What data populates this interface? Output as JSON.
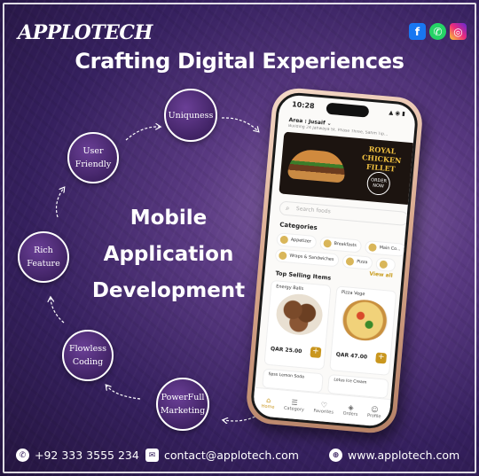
{
  "brand": {
    "logo_text": "APPLOTECH"
  },
  "social": [
    {
      "name": "facebook-icon",
      "glyph": "f"
    },
    {
      "name": "whatsapp-icon",
      "glyph": "✆"
    },
    {
      "name": "instagram-icon",
      "glyph": "◎"
    }
  ],
  "headline": "Crafting Digital Experiences",
  "center": {
    "line1": "Mobile",
    "line2": "Application",
    "line3": "Development"
  },
  "features": {
    "uniqueness": "Uniquness",
    "user_friendly_1": "User",
    "user_friendly_2": "Friendly",
    "rich_feature_1": "Rich",
    "rich_feature_2": "Feature",
    "flawless_coding_1": "Flowless",
    "flawless_coding_2": "Coding",
    "marketing_1": "PowerFull",
    "marketing_2": "Marketing"
  },
  "phone": {
    "time": "10:28",
    "status": "▲ ◉ ▮",
    "area": "Area : Jusaif  ⌄",
    "address": "Building 24 Jahwaya St. Phase Three, Sahm Tip...",
    "banner_title": "ROYAL CHICKEN FILLET",
    "banner_badge": "ORDER NOW",
    "search_placeholder": "Search foods",
    "categories_heading": "Categories",
    "categories_row1": [
      "Appetizer",
      "Breakfasts",
      "Main Co..."
    ],
    "categories_row2": [
      "Wraps & Sandwiches",
      "Pizza",
      ""
    ],
    "view_all": "View all",
    "top_selling_heading": "Top Selling Items",
    "item1_name": "Energy Balls",
    "item1_price": "QAR 25.00",
    "item2_name": "Pizza Vege",
    "item2_price": "QAR 47.00",
    "item3_name": "Spss Lemon Soda",
    "item4_name": "Lotus Ice Cream",
    "tabs": [
      "Home",
      "Category",
      "Favorites",
      "Orders",
      "Profile"
    ]
  },
  "footer": {
    "phone": "+92 333 3555 234",
    "email": "contact@applotech.com",
    "website": "www.applotech.com"
  }
}
